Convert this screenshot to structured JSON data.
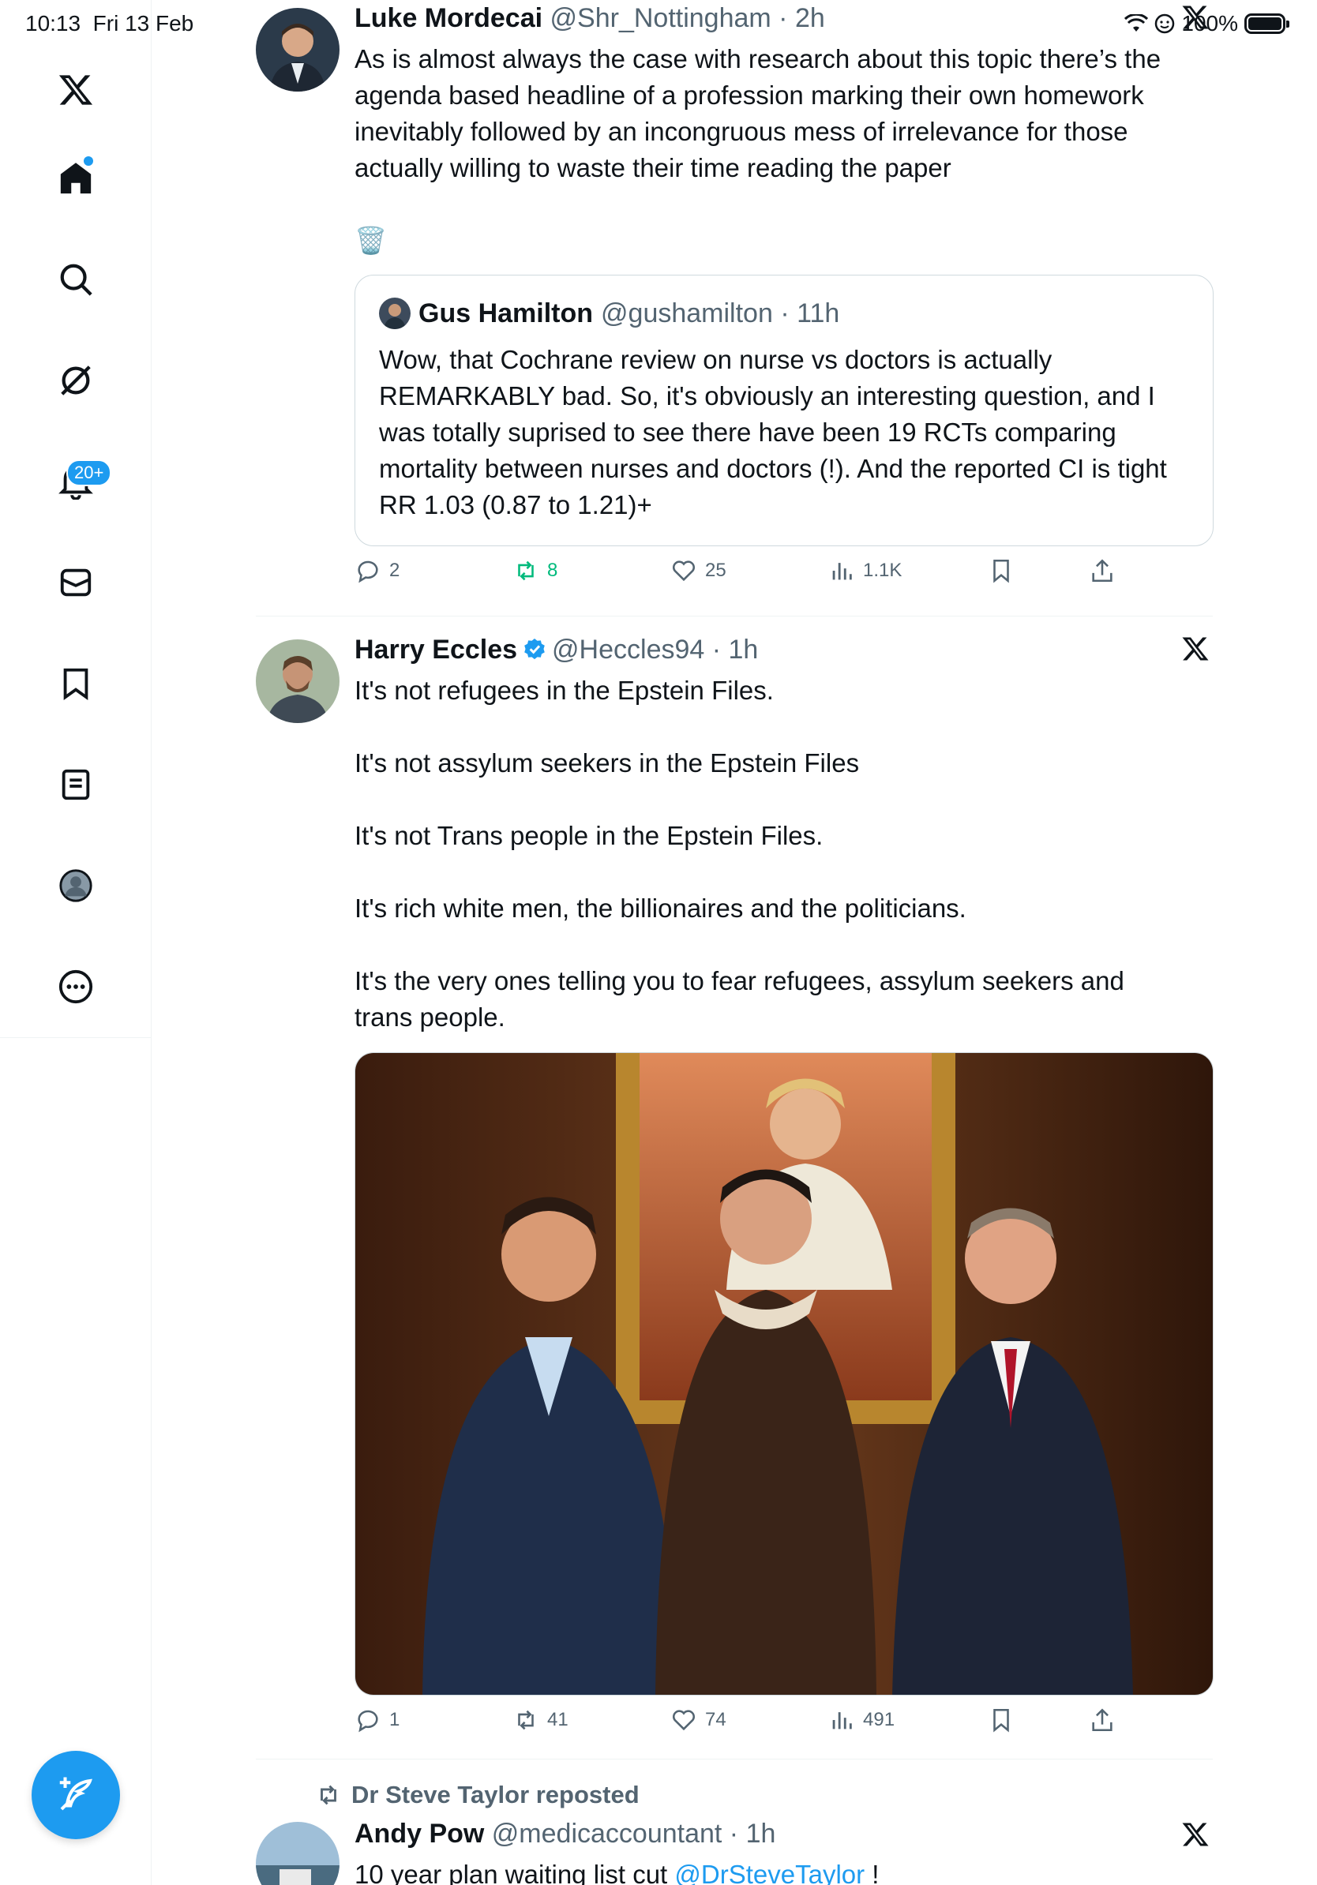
{
  "status_bar": {
    "time": "10:13",
    "date": "Fri 13 Feb",
    "battery": "100%"
  },
  "sidebar": {
    "items": [
      {
        "icon": "x-logo-icon",
        "label": "X"
      },
      {
        "icon": "home-icon",
        "label": "Home"
      },
      {
        "icon": "search-icon",
        "label": "Explore"
      },
      {
        "icon": "grok-icon",
        "label": "Grok"
      },
      {
        "icon": "bell-icon",
        "label": "Notifications"
      },
      {
        "icon": "mail-icon",
        "label": "Messages"
      },
      {
        "icon": "bookmark-icon",
        "label": "Bookmarks"
      },
      {
        "icon": "list-icon",
        "label": "Lists"
      },
      {
        "icon": "profile-icon",
        "label": "Profile"
      },
      {
        "icon": "more-icon",
        "label": "More"
      }
    ],
    "notifications_badge": "20+"
  },
  "tweets": [
    {
      "name": "Luke Mordecai",
      "meta": "@Shr_Nottingham · 2h",
      "text": [
        "As is almost always the case with research about this topic there’s the agenda based headline of a profession marking their own homework inevitably followed by an incongruous mess of irrelevance for those actually willing to waste their time reading the paper",
        "🗑️"
      ],
      "quote": {
        "name": "Gus Hamilton",
        "meta": "@gushamilton · 11h",
        "text": "Wow, that Cochrane review on nurse vs doctors is actually REMARKABLY bad. So, it's obviously an interesting question, and I was totally suprised to see there have been 19 RCTs comparing mortality between nurses and doctors (!). And the reported CI is tight RR 1.03 (0.87 to 1.21)+"
      },
      "actions": {
        "replies": "2",
        "reposts": "8",
        "likes": "25",
        "views": "1.1K"
      }
    },
    {
      "name": "Harry Eccles",
      "meta": "@Heccles94 · 1h",
      "text": [
        "It's not refugees in the Epstein Files.",
        "It's not assylum seekers in the Epstein Files",
        "It's not Trans people in the Epstein Files.",
        "It's rich white men, the billionaires and the politicians.",
        "It's the very ones telling you to fear  refugees, assylum seekers and trans people."
      ],
      "actions": {
        "replies": "1",
        "reposts": "41",
        "likes": "74",
        "views": "491"
      }
    },
    {
      "repost_label": "Dr Steve Taylor reposted",
      "name": "Andy Pow",
      "meta": "@medicaccountant · 1h",
      "text_prefix": "10 year plan waiting list cut ",
      "text_link": "@DrSteveTaylor",
      "text_suffix": " !"
    }
  ],
  "colors": {
    "accent": "#1d9bf0",
    "repost_green": "#00ba7c",
    "muted": "#536471"
  }
}
